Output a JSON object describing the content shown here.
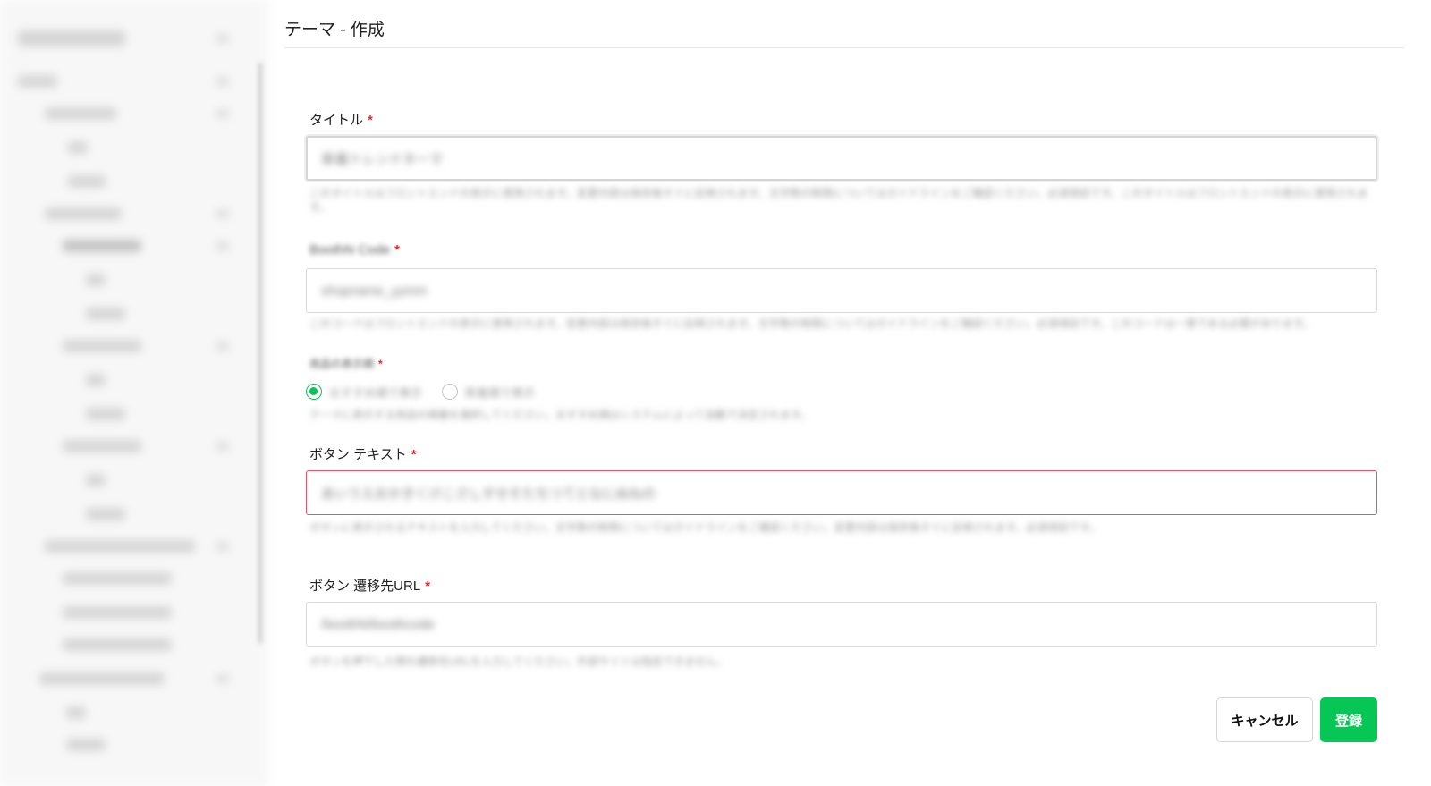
{
  "page": {
    "title": "テーマ - 作成"
  },
  "form": {
    "title_field": {
      "label": "タイトル",
      "required_mark": "*",
      "value": "新着トレンドネーマ",
      "hint": "このタイトルはフロントエンドの表示に使用されます。変更内容は保存後すぐに反映されます。文字数の制限についてはガイドラインをご確認ください。必須項目です。このタイトルはフロントエンドの表示に使用されます。"
    },
    "code_field": {
      "label": "BoothN Code",
      "required_mark": "*",
      "value": "shopname_yymm",
      "hint": "このコードはフロントエンドの表示に使用されます。変更内容は保存後すぐに反映されます。文字数の制限についてはガイドラインをご確認ください。必須項目です。このコードは一意である必要があります。"
    },
    "display_field": {
      "label": "商品の表示順",
      "required_mark": "*",
      "options": [
        "おすすめ順で表示",
        "新着順で表示"
      ],
      "hint": "テーマに表示する商品の順番を選択してください。おすすめ順はシステムによって自動で決定されます。"
    },
    "button_text_field": {
      "label": "ボタン テキスト",
      "required_mark": "*",
      "value": "あいうえおかきくけこさしすせそたちつてとなにぬねの",
      "hint": "ボタンに表示されるテキストを入力してください。文字数の制限についてはガイドラインをご確認ください。変更内容は保存後すぐに反映されます。必須項目です。"
    },
    "button_url_field": {
      "label": "ボタン 遷移先URL",
      "required_mark": "*",
      "value": "/boothN/boothcode",
      "hint": "ボタンを押下した際の遷移先URLを入力してください。外部サイトは指定できません。"
    }
  },
  "actions": {
    "cancel_label": "キャンセル",
    "submit_label": "登録"
  },
  "colors": {
    "accent": "#06c755",
    "error": "#e8556b",
    "required": "#e02b2b"
  }
}
